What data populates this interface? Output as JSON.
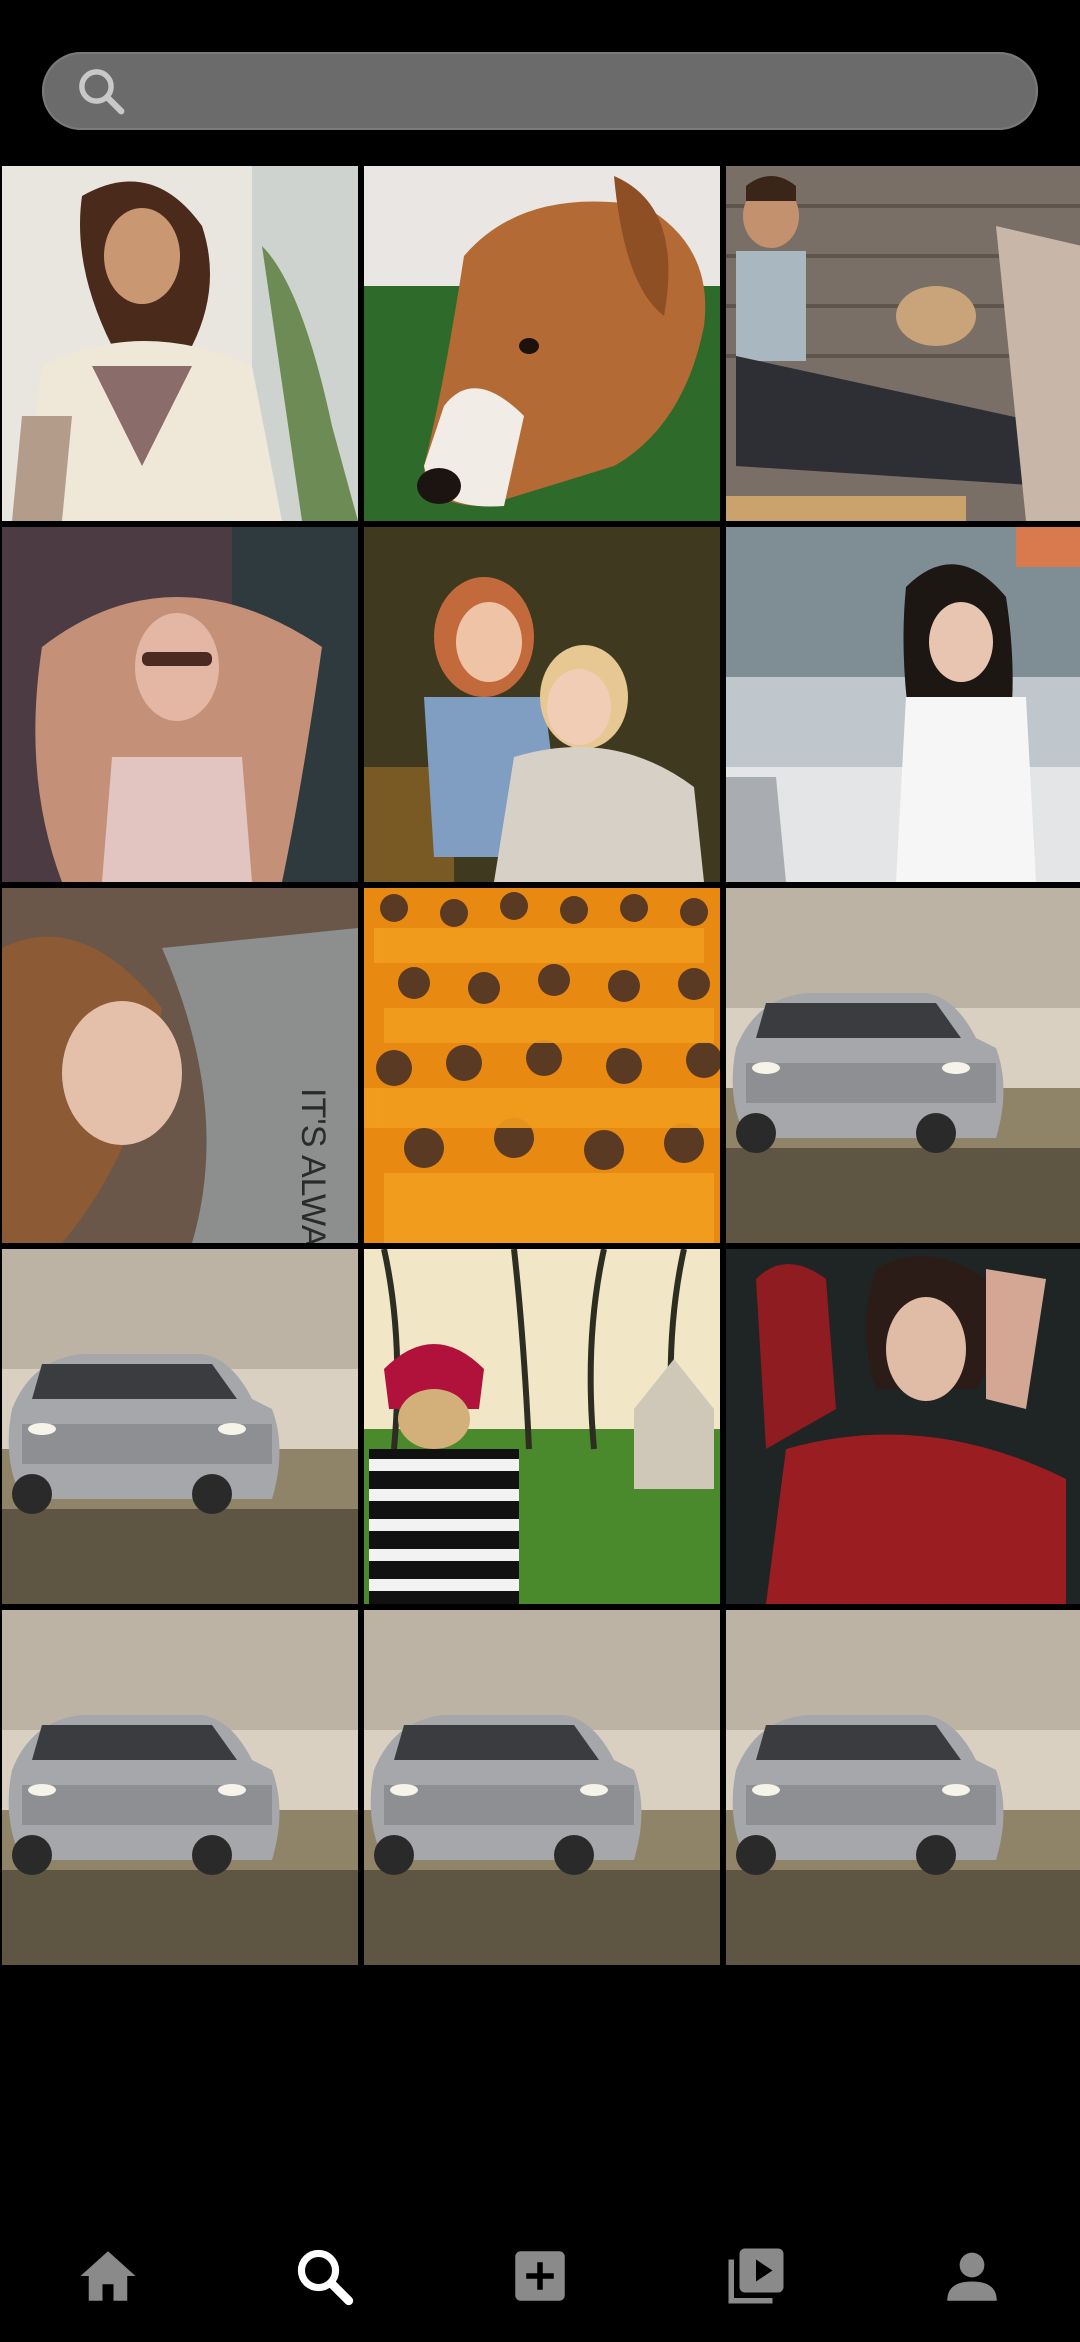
{
  "search": {
    "placeholder": "",
    "value": "",
    "icon": "search-icon"
  },
  "grid": {
    "tiles": [
      {
        "subject": "woman-embroidered-dress"
      },
      {
        "subject": "dog-on-grass"
      },
      {
        "subject": "man-with-pug"
      },
      {
        "subject": "woman-flowing-hair"
      },
      {
        "subject": "girls-hugging"
      },
      {
        "subject": "woman-white-shirt"
      },
      {
        "subject": "woman-lying-its-always-shirt"
      },
      {
        "subject": "monks-orange-robes"
      },
      {
        "subject": "suv-in-field"
      },
      {
        "subject": "suv-in-field"
      },
      {
        "subject": "child-red-hat-playhouse"
      },
      {
        "subject": "woman-red-top"
      },
      {
        "subject": "suv-in-field"
      },
      {
        "subject": "suv-in-field"
      },
      {
        "subject": "suv-in-field"
      }
    ]
  },
  "bottom_nav": {
    "items": [
      {
        "icon": "home-icon",
        "active": false
      },
      {
        "icon": "search-icon",
        "active": true
      },
      {
        "icon": "add-box-icon",
        "active": false
      },
      {
        "icon": "video-library-icon",
        "active": false
      },
      {
        "icon": "profile-icon",
        "active": false
      }
    ]
  },
  "colors": {
    "background": "#000000",
    "search_bar": "#6b6b6b",
    "icon_inactive": "#8a8a8a",
    "icon_active": "#ffffff"
  }
}
